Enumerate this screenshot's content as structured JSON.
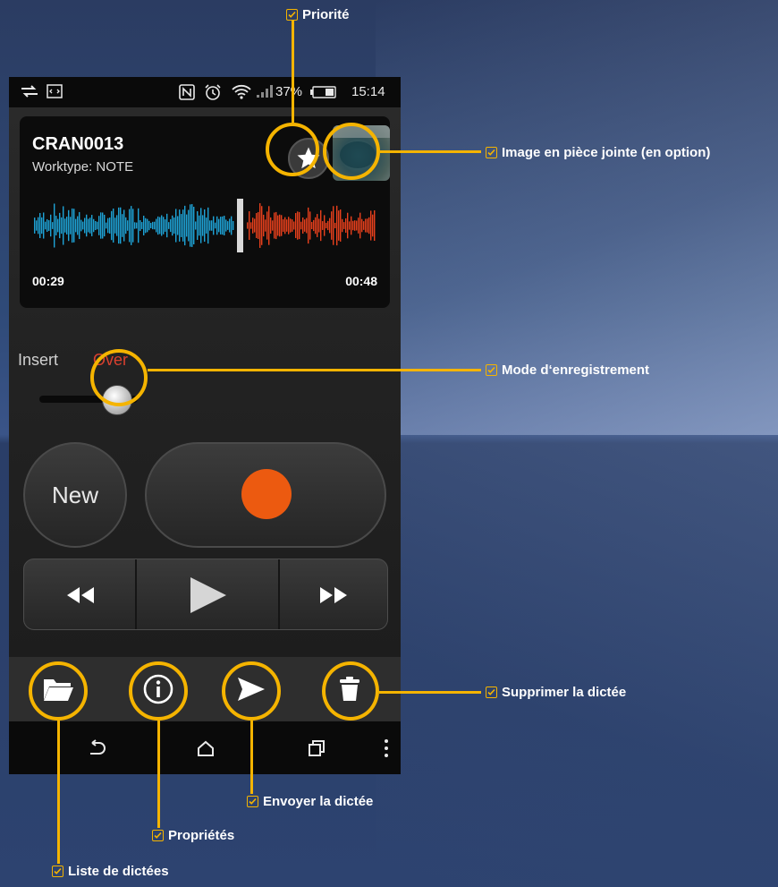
{
  "status_bar": {
    "battery": "37%",
    "time": "15:14"
  },
  "recording": {
    "file_name": "CRAN0013",
    "worktype": "Worktype:  NOTE",
    "time_elapsed": "00:29",
    "time_total": "00:48",
    "progress": 0.6
  },
  "mode": {
    "insert_label": "Insert",
    "over_label": "Over",
    "active": "Over"
  },
  "controls": {
    "new_label": "New"
  },
  "annotations": {
    "priority": "Priorité",
    "image": "Image en pièce jointe (en option)",
    "mode": "Mode d‘enregistrement",
    "delete": "Supprimer la dictée",
    "send": "Envoyer la dictée",
    "properties": "Propriétés",
    "list": "Liste de dictées"
  },
  "colors": {
    "accent": "#f5b400",
    "record": "#ec5a10",
    "wave_played": "#1ea3d6",
    "wave_remaining": "#e8401c",
    "over_mode": "#d8402f"
  }
}
